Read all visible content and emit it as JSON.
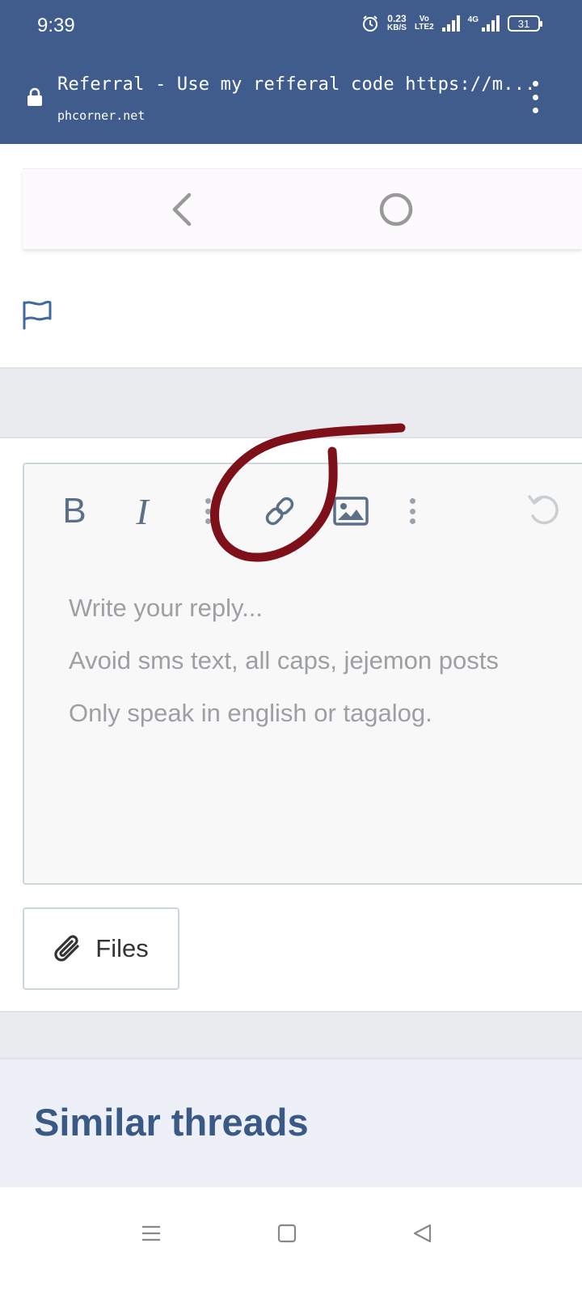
{
  "status_bar": {
    "time": "9:39",
    "speed_value": "0.23",
    "speed_unit": "KB/S",
    "volte_top": "Vo",
    "volte_bottom": "LTE2",
    "net_type": "4G",
    "battery": "31"
  },
  "browser": {
    "page_title": "Referral - Use my refferal code https://m...",
    "domain": "phcorner.net"
  },
  "editor": {
    "toolbar": {
      "bold_label": "B",
      "italic_label": "I",
      "icons": [
        "more-vert-icon",
        "link-icon",
        "image-icon",
        "more-vert-icon",
        "undo-icon"
      ]
    },
    "placeholder_lines": [
      "Write your reply...",
      "Avoid sms text, all caps, jejemon posts",
      "Only speak in english or tagalog."
    ],
    "files_label": "Files"
  },
  "similar_threads": {
    "title": "Similar threads"
  },
  "colors": {
    "header": "#3f5c8c",
    "annotation": "#7d1018",
    "heading": "#3a5a85"
  }
}
